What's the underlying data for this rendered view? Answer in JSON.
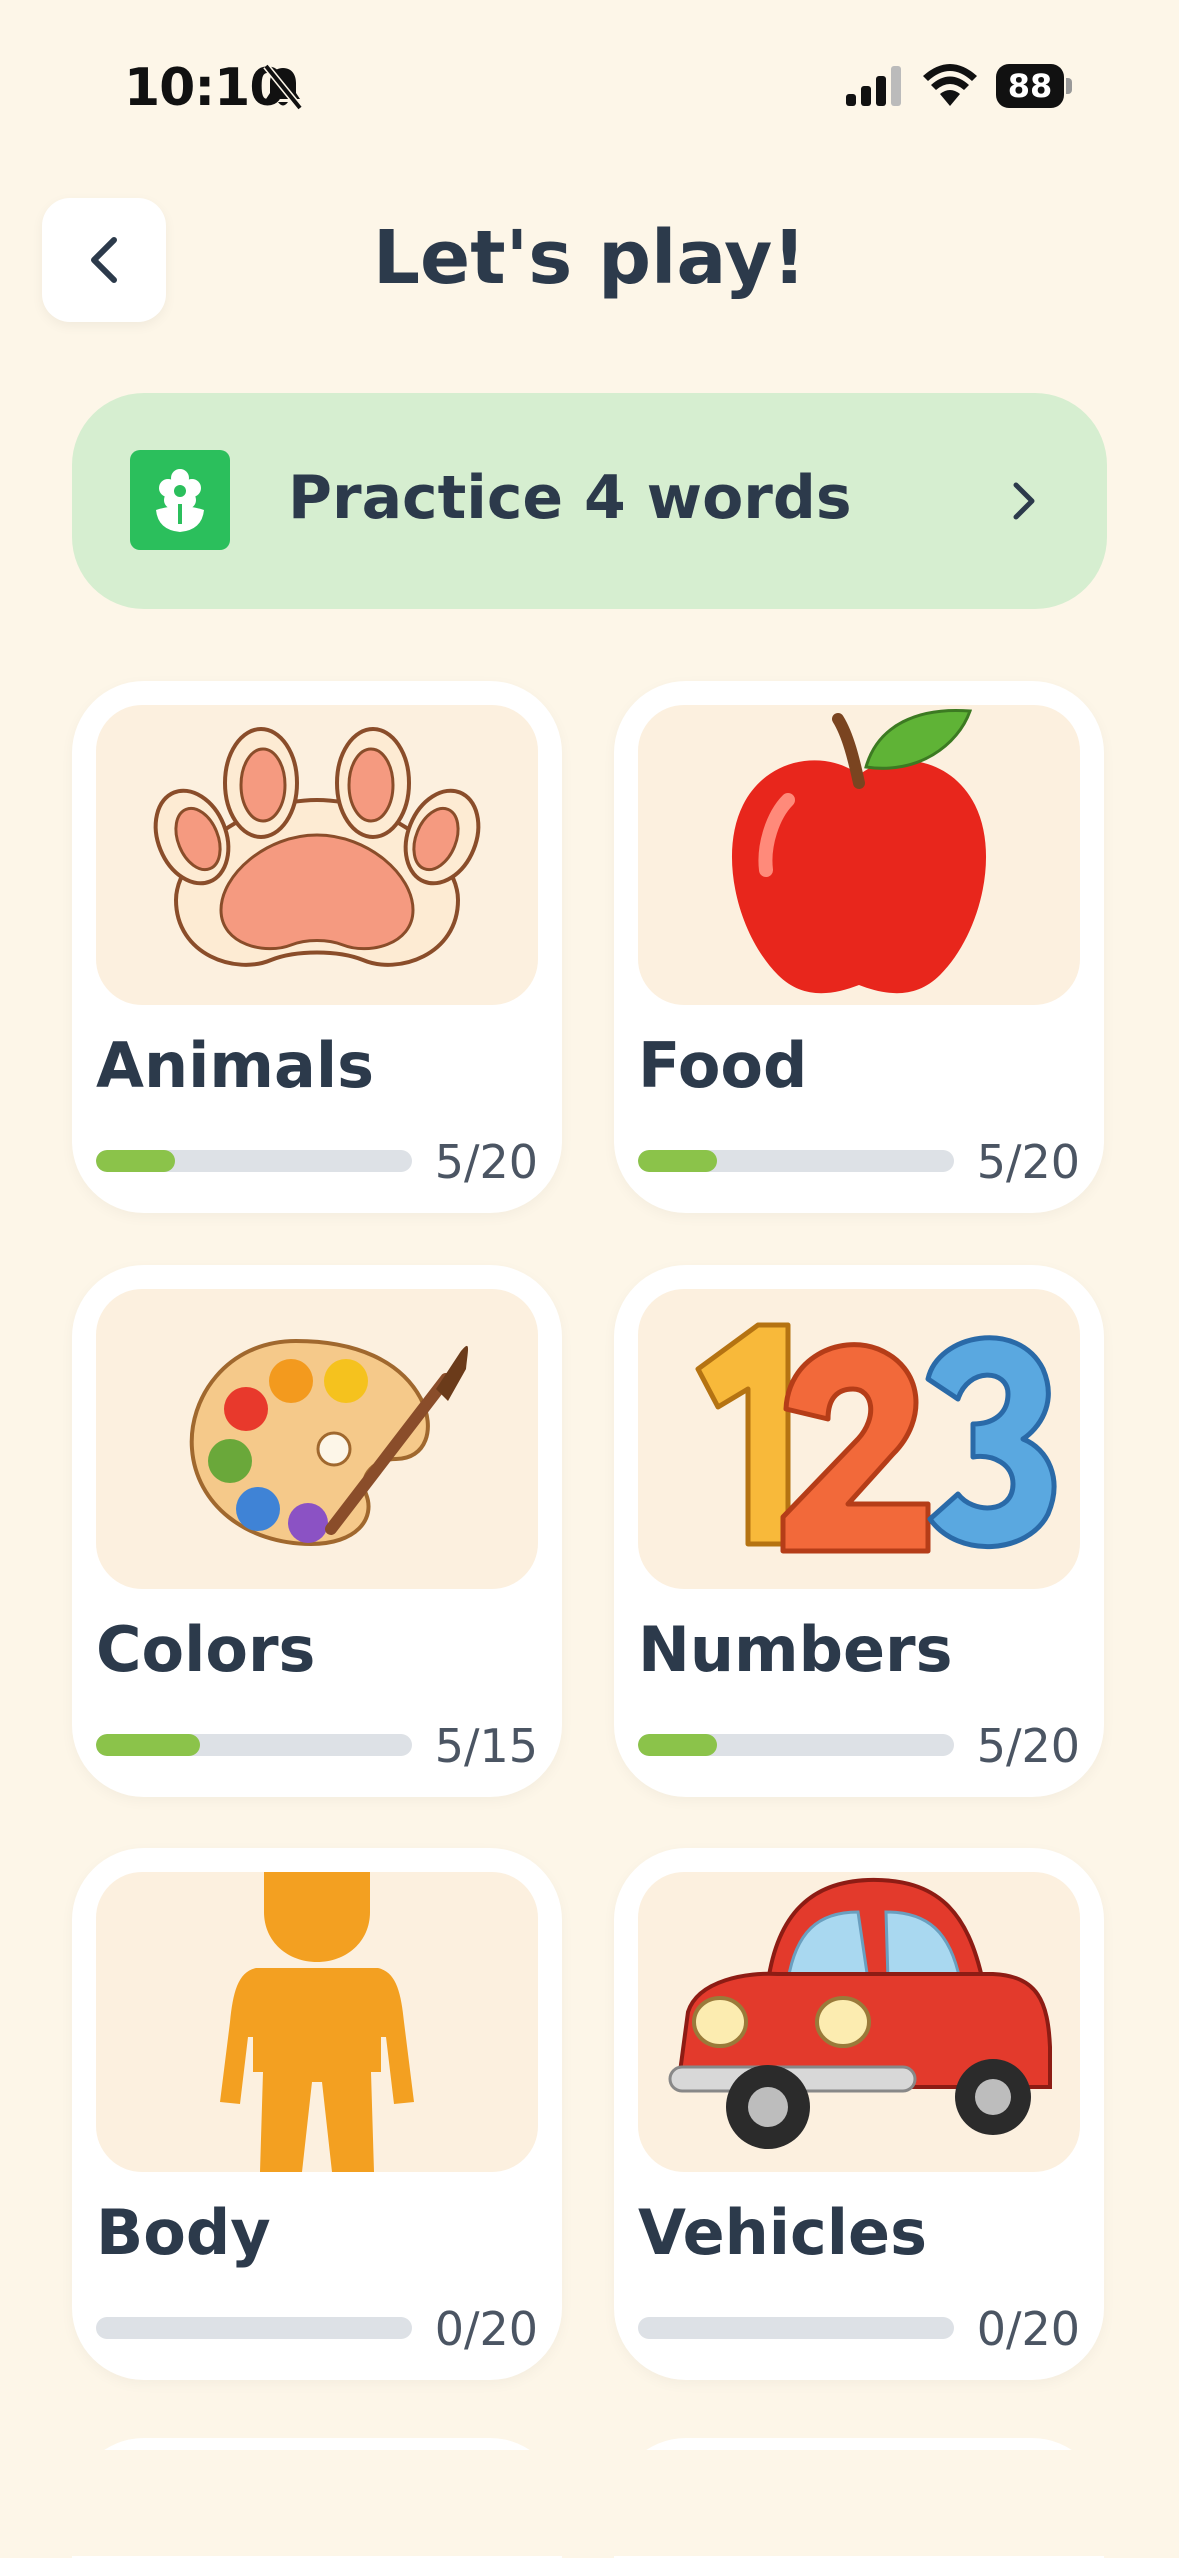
{
  "status_bar": {
    "time": "10:10",
    "battery": "88",
    "icons": [
      "bell-slash-icon",
      "signal-icon",
      "wifi-icon",
      "battery-icon"
    ]
  },
  "header": {
    "title": "Let's play!",
    "back_icon": "chevron-left-icon"
  },
  "practice": {
    "label": "Practice 4 words",
    "icon": "flower-icon",
    "chevron_icon": "chevron-right-icon",
    "accent": "#2bbf5c",
    "background": "#d6eed0"
  },
  "categories": [
    {
      "name": "Animals",
      "count": "5/20",
      "progress": 0.25,
      "icon": "paw-icon"
    },
    {
      "name": "Food",
      "count": "5/20",
      "progress": 0.25,
      "icon": "apple-icon"
    },
    {
      "name": "Colors",
      "count": "5/15",
      "progress": 0.33,
      "icon": "palette-icon"
    },
    {
      "name": "Numbers",
      "count": "5/20",
      "progress": 0.25,
      "icon": "numbers-icon"
    },
    {
      "name": "Body",
      "count": "0/20",
      "progress": 0,
      "icon": "person-icon"
    },
    {
      "name": "Vehicles",
      "count": "0/20",
      "progress": 0,
      "icon": "car-icon"
    }
  ],
  "colors": {
    "background": "#fdf6e8",
    "progress_fill": "#8bc34a",
    "progress_track": "#dde1e6",
    "text": "#2c3a4b"
  }
}
